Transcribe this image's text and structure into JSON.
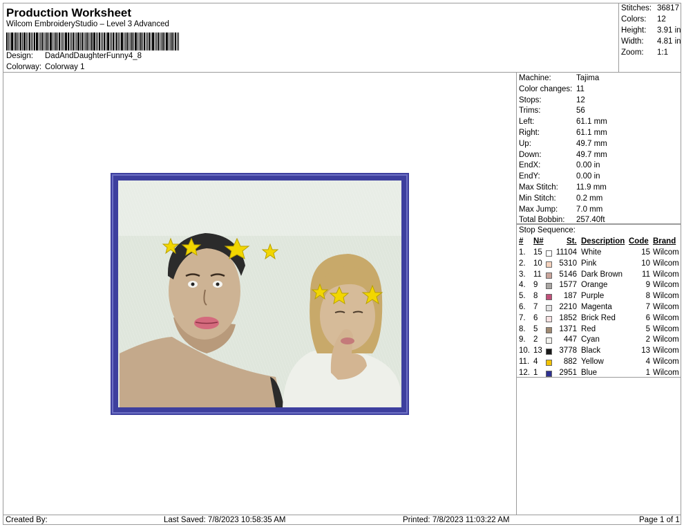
{
  "header": {
    "title": "Production Worksheet",
    "subtitle": "Wilcom EmbroideryStudio – Level 3 Advanced",
    "design_label": "Design:",
    "design_value": "DadAndDaughterFunny4_8",
    "colorway_label": "Colorway:",
    "colorway_value": "Colorway 1"
  },
  "stats": [
    {
      "label": "Stitches:",
      "value": "36817"
    },
    {
      "label": "Colors:",
      "value": "12"
    },
    {
      "label": "Height:",
      "value": "3.91 in"
    },
    {
      "label": "Width:",
      "value": "4.81 in"
    },
    {
      "label": "Zoom:",
      "value": "1:1"
    }
  ],
  "machine_info": [
    {
      "label": "Machine:",
      "value": "Tajima"
    },
    {
      "label": "Color changes:",
      "value": "11"
    },
    {
      "label": "Stops:",
      "value": "12"
    },
    {
      "label": "Trims:",
      "value": "56"
    },
    {
      "label": "Left:",
      "value": "61.1 mm"
    },
    {
      "label": "Right:",
      "value": "61.1 mm"
    },
    {
      "label": "Up:",
      "value": "49.7 mm"
    },
    {
      "label": "Down:",
      "value": "49.7 mm"
    },
    {
      "label": "EndX:",
      "value": "0.00 in"
    },
    {
      "label": "EndY:",
      "value": "0.00 in"
    },
    {
      "label": "Max Stitch:",
      "value": "11.9 mm"
    },
    {
      "label": "Min Stitch:",
      "value": "0.2 mm"
    },
    {
      "label": "Max Jump:",
      "value": "7.0 mm"
    },
    {
      "label": "Total Bobbin:",
      "value": "257.40ft"
    }
  ],
  "stop_sequence": {
    "title": "Stop Sequence:",
    "headers": {
      "idx": "#",
      "n": "N#",
      "st": "St.",
      "desc": "Description",
      "code": "Code",
      "brand": "Brand"
    },
    "rows": [
      {
        "idx": "1.",
        "n": "15",
        "color": "#ffffff",
        "st": "11104",
        "desc": "White",
        "code": "15",
        "brand": "Wilcom"
      },
      {
        "idx": "2.",
        "n": "10",
        "color": "#f5d2bd",
        "st": "5310",
        "desc": "Pink",
        "code": "10",
        "brand": "Wilcom"
      },
      {
        "idx": "3.",
        "n": "11",
        "color": "#c9a59b",
        "st": "5146",
        "desc": "Dark Brown",
        "code": "11",
        "brand": "Wilcom"
      },
      {
        "idx": "4.",
        "n": "9",
        "color": "#a9a6a3",
        "st": "1577",
        "desc": "Orange",
        "code": "9",
        "brand": "Wilcom"
      },
      {
        "idx": "5.",
        "n": "8",
        "color": "#c0507a",
        "st": "187",
        "desc": "Purple",
        "code": "8",
        "brand": "Wilcom"
      },
      {
        "idx": "6.",
        "n": "7",
        "color": "#e3e3e3",
        "st": "2210",
        "desc": "Magenta",
        "code": "7",
        "brand": "Wilcom"
      },
      {
        "idx": "7.",
        "n": "6",
        "color": "#f7e2e2",
        "st": "1852",
        "desc": "Brick Red",
        "code": "6",
        "brand": "Wilcom"
      },
      {
        "idx": "8.",
        "n": "5",
        "color": "#a08a72",
        "st": "1371",
        "desc": "Red",
        "code": "5",
        "brand": "Wilcom"
      },
      {
        "idx": "9.",
        "n": "2",
        "color": "#f2f1ec",
        "st": "447",
        "desc": "Cyan",
        "code": "2",
        "brand": "Wilcom"
      },
      {
        "idx": "10.",
        "n": "13",
        "color": "#1a1a1a",
        "st": "3778",
        "desc": "Black",
        "code": "13",
        "brand": "Wilcom"
      },
      {
        "idx": "11.",
        "n": "4",
        "color": "#f2c200",
        "st": "882",
        "desc": "Yellow",
        "code": "4",
        "brand": "Wilcom"
      },
      {
        "idx": "12.",
        "n": "1",
        "color": "#2e3192",
        "st": "2951",
        "desc": "Blue",
        "code": "1",
        "brand": "Wilcom"
      }
    ]
  },
  "footer": {
    "created_by": "Created By:",
    "last_saved": "Last Saved: 7/8/2023 10:58:35 AM",
    "printed": "Printed: 7/8/2023 11:03:22 AM",
    "page": "Page 1 of 1"
  },
  "design_colors": {
    "frame": "#3d3f9e",
    "background": "#dfe6dc",
    "skin": "#cdb394",
    "hair_dark": "#2b2b2b",
    "hair_light": "#c8a96a",
    "star": "#f2d600"
  }
}
